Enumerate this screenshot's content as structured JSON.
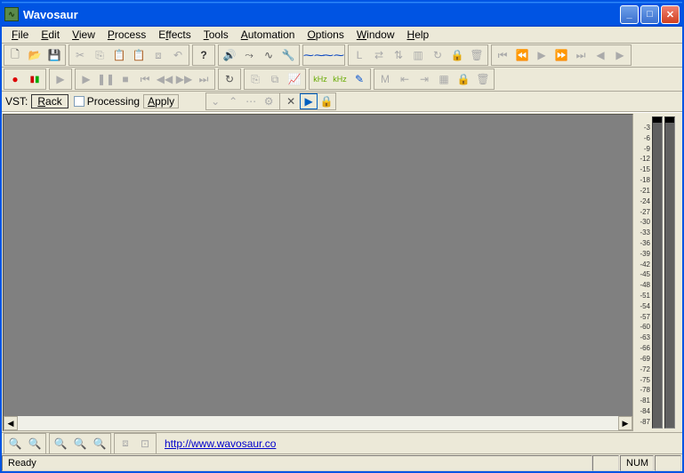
{
  "title": "Wavosaur",
  "menu": {
    "file": "File",
    "edit": "Edit",
    "view": "View",
    "process": "Process",
    "effects": "Effects",
    "tools": "Tools",
    "automation": "Automation",
    "options": "Options",
    "window": "Window",
    "help": "Help"
  },
  "vst": {
    "label": "VST:",
    "rack": "Rack",
    "processing": "Processing",
    "apply": "Apply"
  },
  "link": "http://www.wavosaur.co",
  "status": {
    "ready": "Ready",
    "num": "NUM"
  },
  "meter": {
    "scale": [
      "-3",
      "-6",
      "-9",
      "-12",
      "-15",
      "-18",
      "-21",
      "-24",
      "-27",
      "-30",
      "-33",
      "-36",
      "-39",
      "-42",
      "-45",
      "-48",
      "-51",
      "-54",
      "-57",
      "-60",
      "-63",
      "-66",
      "-69",
      "-72",
      "-75",
      "-78",
      "-81",
      "-84",
      "-87"
    ]
  },
  "toolbar1_icons": [
    "new",
    "open",
    "save",
    "cut",
    "copy",
    "paste",
    "paste-special",
    "crop",
    "undo",
    "help",
    "volume",
    "route",
    "cable",
    "wrench",
    "waveform-blue",
    "waveform-sel",
    "marker-l",
    "swap-h",
    "swap-v",
    "region",
    "loop",
    "lock",
    "trash",
    "skip-start",
    "skip-prev",
    "play-region",
    "skip-next",
    "skip-end",
    "prev",
    "play"
  ],
  "toolbar2_icons": [
    "record",
    "levels",
    "play-out",
    "play",
    "pause",
    "stop",
    "rewind-full",
    "rewind",
    "forward",
    "forward-full",
    "loop-toggle",
    "paste-insert",
    "replace",
    "chart",
    "zoom-h",
    "zoom-v",
    "pencil",
    "marker-m",
    "move-left",
    "move-right",
    "fit",
    "lock2",
    "trash2"
  ],
  "vst_tools": [
    "expand",
    "collapse",
    "link",
    "settings",
    "delete",
    "play-vst",
    "lock-vst"
  ],
  "zoom_icons": [
    "zoom-in",
    "zoom-out",
    "zoom-sel",
    "zoom-all",
    "zoom-v",
    "crop-zoom",
    "fit-zoom"
  ]
}
